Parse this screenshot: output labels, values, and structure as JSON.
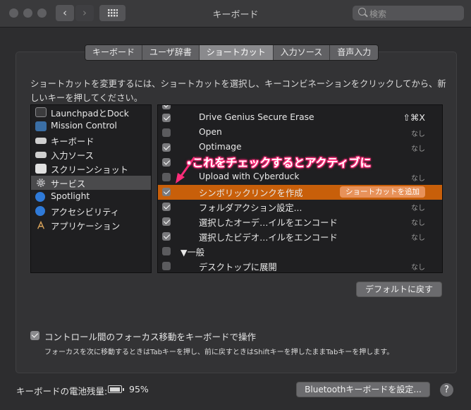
{
  "window": {
    "title": "キーボード",
    "search_placeholder": "検索",
    "back_glyph": "‹",
    "forward_glyph": "›"
  },
  "tabs": [
    {
      "label": "キーボード"
    },
    {
      "label": "ユーザ辞書"
    },
    {
      "label": "ショートカット",
      "selected": true
    },
    {
      "label": "入力ソース"
    },
    {
      "label": "音声入力"
    }
  ],
  "description": "ショートカットを変更するには、ショートカットを選択し、キーコンビネーションをクリックしてから、新しいキーを押してください。",
  "categories": [
    {
      "label": "LaunchpadとDock",
      "icon": "launchpad-icon",
      "color": "#3b3b3d"
    },
    {
      "label": "Mission Control",
      "icon": "mission-control-icon",
      "color": "#3a6ea5"
    },
    {
      "label": "キーボード",
      "icon": "keyboard-icon",
      "color": "#cfcfcf"
    },
    {
      "label": "入力ソース",
      "icon": "input-source-icon",
      "color": "#cfcfcf"
    },
    {
      "label": "スクリーンショット",
      "icon": "screenshot-icon",
      "color": "#e0e0e0"
    },
    {
      "label": "サービス",
      "icon": "gear-icon",
      "color": "#8a8a8d",
      "selected": true
    },
    {
      "label": "Spotlight",
      "icon": "spotlight-icon",
      "color": "#2f7ad8"
    },
    {
      "label": "アクセシビリティ",
      "icon": "accessibility-icon",
      "color": "#2f7ad8"
    },
    {
      "label": "アプリケーション",
      "icon": "app-store-icon",
      "color": "#2f2f31"
    }
  ],
  "shortcuts": [
    {
      "label": "",
      "checked": true,
      "key": ""
    },
    {
      "label": "Drive Genius Secure Erase",
      "checked": true,
      "key": "⇧⌘X"
    },
    {
      "label": "Open",
      "checked": false,
      "key": "なし"
    },
    {
      "label": "Optimage",
      "checked": true,
      "key": "なし"
    },
    {
      "label": "",
      "checked": true,
      "key": ""
    },
    {
      "label": "Upload with Cyberduck",
      "checked": false,
      "key": "なし"
    },
    {
      "label": "シンボリックリンクを作成",
      "checked": true,
      "key": "",
      "selected": true
    },
    {
      "label": "フォルダアクション設定...",
      "checked": true,
      "key": "なし"
    },
    {
      "label": "選択したオーデ…イルをエンコード",
      "checked": true,
      "key": "なし"
    },
    {
      "label": "選択したビデオ…イルをエンコード",
      "checked": true,
      "key": "なし"
    },
    {
      "label": "▼一般",
      "checked": false,
      "key": "",
      "group": true
    },
    {
      "label": "デスクトップに展開",
      "checked": false,
      "key": "なし"
    }
  ],
  "add_shortcut_label": "ショートカットを追加",
  "callout_text": "これをチェックするとアクティブに",
  "restore_default_label": "デフォルトに戻す",
  "focus": {
    "label": "コントロール間のフォーカス移動をキーボードで操作",
    "checked": true,
    "note": "フォーカスを次に移動するときはTabキーを押し、前に戻すときはShiftキーを押したままTabキーを押します。"
  },
  "battery": {
    "label": "キーボードの電池残量:",
    "value": "95%"
  },
  "bluetooth_button_label": "Bluetoothキーボードを設定...",
  "help_glyph": "?",
  "colors": {
    "accent_selection": "#c85f0a",
    "callout": "#ff2d7a"
  }
}
